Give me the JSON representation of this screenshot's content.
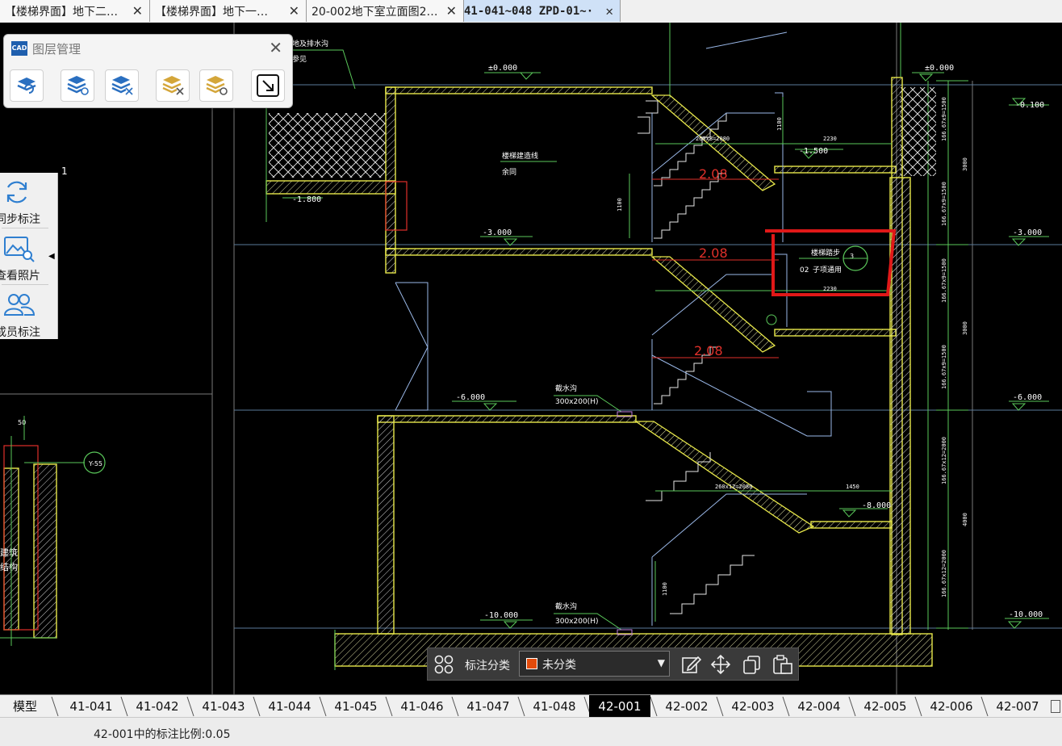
{
  "doc_tabs": [
    {
      "label": "【楼梯界面】地下二…"
    },
    {
      "label": "【楼梯界面】地下一…"
    },
    {
      "label": "20-002地下室立面图2…"
    },
    {
      "label": "41-041~048 ZPD-01~·"
    }
  ],
  "layer_panel": {
    "title": "图层管理",
    "logo": "CAD"
  },
  "side_tools": {
    "items": [
      {
        "label": "同步标注",
        "icon": "sync-icon"
      },
      {
        "label": "查看照片",
        "icon": "photo-icon"
      },
      {
        "label": "成员标注",
        "icon": "members-icon"
      }
    ]
  },
  "annotation_toolbar": {
    "label": "标注分类",
    "selected": "未分类",
    "selected_color": "#e34b0b"
  },
  "sheet_tabs": [
    {
      "label": "模型"
    },
    {
      "label": "41-041"
    },
    {
      "label": "41-042"
    },
    {
      "label": "41-043"
    },
    {
      "label": "41-044"
    },
    {
      "label": "41-045"
    },
    {
      "label": "41-046"
    },
    {
      "label": "41-047"
    },
    {
      "label": "41-048"
    },
    {
      "label": "42-001"
    },
    {
      "label": "42-002"
    },
    {
      "label": "42-003"
    },
    {
      "label": "42-004"
    },
    {
      "label": "42-005"
    },
    {
      "label": "42-006"
    },
    {
      "label": "42-007"
    }
  ],
  "active_sheet": "42-001",
  "status": {
    "text": "42-001中的标注比例:0.05"
  },
  "drawing": {
    "elevations": [
      "±0.000",
      "-3.000",
      "-6.000",
      "-10.000",
      "±0.000",
      "-0.100",
      "-3.000",
      "-6.000",
      "-10.000",
      "-1.500",
      "-8.000",
      "-1.800"
    ],
    "dims_red": [
      "2.08",
      "2.08",
      "2.08"
    ],
    "notes": [
      "楼梯建造线",
      "余同",
      "截水沟",
      "300x200(H)",
      "截水沟",
      "300x200(H)",
      "楼梯踏步",
      "02",
      "子项通用",
      "1",
      "Y-55",
      "50",
      "3"
    ],
    "dims_small": [
      "260x8=2080",
      "2230",
      "2230",
      "260x12=2080",
      "1450",
      "1100",
      "1100",
      "1100",
      "3000",
      "3000",
      "4000",
      "166.67x9=1500",
      "166.67x9=1500",
      "166.67x9=1500",
      "166.67x9=1500",
      "166.67x12=2000",
      "166.67x12=2000"
    ],
    "side_notes": [
      "地及排水沟",
      "参见",
      "建筑",
      "结构"
    ]
  }
}
